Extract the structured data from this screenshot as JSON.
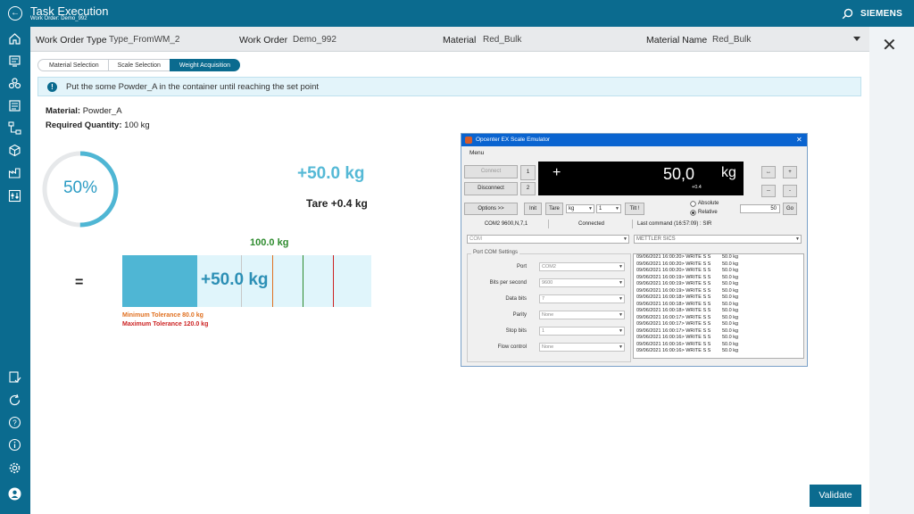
{
  "header": {
    "title": "Task Execution",
    "subtitle": "Work Order: Demo_992",
    "brand": "SIEMENS"
  },
  "work_order": {
    "type_label": "Work Order Type",
    "type_value": "Type_FromWM_2",
    "wo_label": "Work Order",
    "wo_value": "Demo_992",
    "material_label": "Material",
    "material_value": "Red_Bulk",
    "material_name_label": "Material Name",
    "material_name_value": "Red_Bulk"
  },
  "wizard": {
    "steps": [
      "Material Selection",
      "Scale Selection",
      "Weight Acquisition"
    ],
    "active_index": 2
  },
  "info": {
    "message": "Put the some Powder_A in the container until reaching the set point"
  },
  "material": {
    "material_label": "Material:",
    "material_value": "Powder_A",
    "qty_label": "Required Quantity:",
    "qty_value": "100 kg"
  },
  "progress": {
    "percent_text": "50%",
    "percent_value": 0.5
  },
  "weight": {
    "current": "+50.0 kg",
    "tare": "Tare +0.4 kg",
    "equals": "=",
    "setpoint_label": "100.0 kg",
    "bar_fraction": 0.5,
    "min_tolerance": "Minimum Tolerance 80.0 kg",
    "max_tolerance": "Maximum Tolerance 120.0 kg"
  },
  "emulator": {
    "title": "Opcenter EX Scale Emulator",
    "close": "✕",
    "menu": "Menu",
    "connect": "Connect",
    "disconnect": "Disconnect",
    "ch1": "1",
    "ch2": "2",
    "display_sign": "+",
    "display_value": "50,0",
    "display_unit": "kg",
    "display_tare": "+0.4",
    "arrows_h": "↔",
    "plus": "+",
    "dash1": "--",
    "minus": "-",
    "options": "Options >>",
    "init": "Init",
    "tare": "Tare",
    "unit_sel": "kg",
    "num_sel": "1",
    "tilt": "Tilt !",
    "absolute": "Absolute",
    "relative": "Relative",
    "go_value": "50",
    "go": "Go",
    "com_settings": "COM2 9600,N,7,1",
    "connected": "Connected",
    "last_command": "Last command (16:57:09) : SIR",
    "com_sel": "COM",
    "brand_sel": "METTLER SICS",
    "port_group": "Port COM Settings",
    "fields": [
      {
        "label": "Port",
        "value": "COM2"
      },
      {
        "label": "Bits per second",
        "value": "9600"
      },
      {
        "label": "Data bits",
        "value": "7"
      },
      {
        "label": "Parity",
        "value": "None"
      },
      {
        "label": "Stop bits",
        "value": "1"
      },
      {
        "label": "Flow control",
        "value": "None"
      }
    ],
    "log": [
      {
        "ts": "09/06/2021 16:00:20> WRITE S S",
        "v": "50.0 kg"
      },
      {
        "ts": "09/06/2021 16:00:20> WRITE S S",
        "v": "50.0 kg"
      },
      {
        "ts": "09/06/2021 16:00:20> WRITE S S",
        "v": "50.0 kg"
      },
      {
        "ts": "09/06/2021 16:00:19> WRITE S S",
        "v": "50.0 kg"
      },
      {
        "ts": "09/06/2021 16:00:19> WRITE S S",
        "v": "50.0 kg"
      },
      {
        "ts": "09/06/2021 16:00:19> WRITE S S",
        "v": "50.0 kg"
      },
      {
        "ts": "09/06/2021 16:00:18> WRITE S S",
        "v": "50.0 kg"
      },
      {
        "ts": "09/06/2021 16:00:18> WRITE S S",
        "v": "50.0 kg"
      },
      {
        "ts": "09/06/2021 16:00:18> WRITE S S",
        "v": "50.0 kg"
      },
      {
        "ts": "09/06/2021 16:00:17> WRITE S S",
        "v": "50.0 kg"
      },
      {
        "ts": "09/06/2021 16:00:17> WRITE S S",
        "v": "50.0 kg"
      },
      {
        "ts": "09/06/2021 16:00:17> WRITE S S",
        "v": "50.0 kg"
      },
      {
        "ts": "09/06/2021 16:00:16> WRITE S S",
        "v": "50.0 kg"
      },
      {
        "ts": "09/06/2021 16:00:16> WRITE S S",
        "v": "50.0 kg"
      },
      {
        "ts": "09/06/2021 16:00:16> WRITE S S",
        "v": "50.0 kg"
      }
    ]
  },
  "actions": {
    "validate": "Validate"
  },
  "colors": {
    "brand": "#0b6b8f",
    "progress": "#4fb6d4",
    "setpoint": "#2e8b2e",
    "min_tolerance": "#e07020",
    "max_tolerance": "#cc2222"
  },
  "nav_icons": [
    "home-icon",
    "report-icon",
    "materials-icon",
    "list-icon",
    "workflow-icon",
    "package-icon",
    "factory-icon",
    "sliders-icon",
    "checklist-icon",
    "refresh-icon",
    "help-icon",
    "info-icon",
    "settings-icon",
    "user-icon"
  ]
}
